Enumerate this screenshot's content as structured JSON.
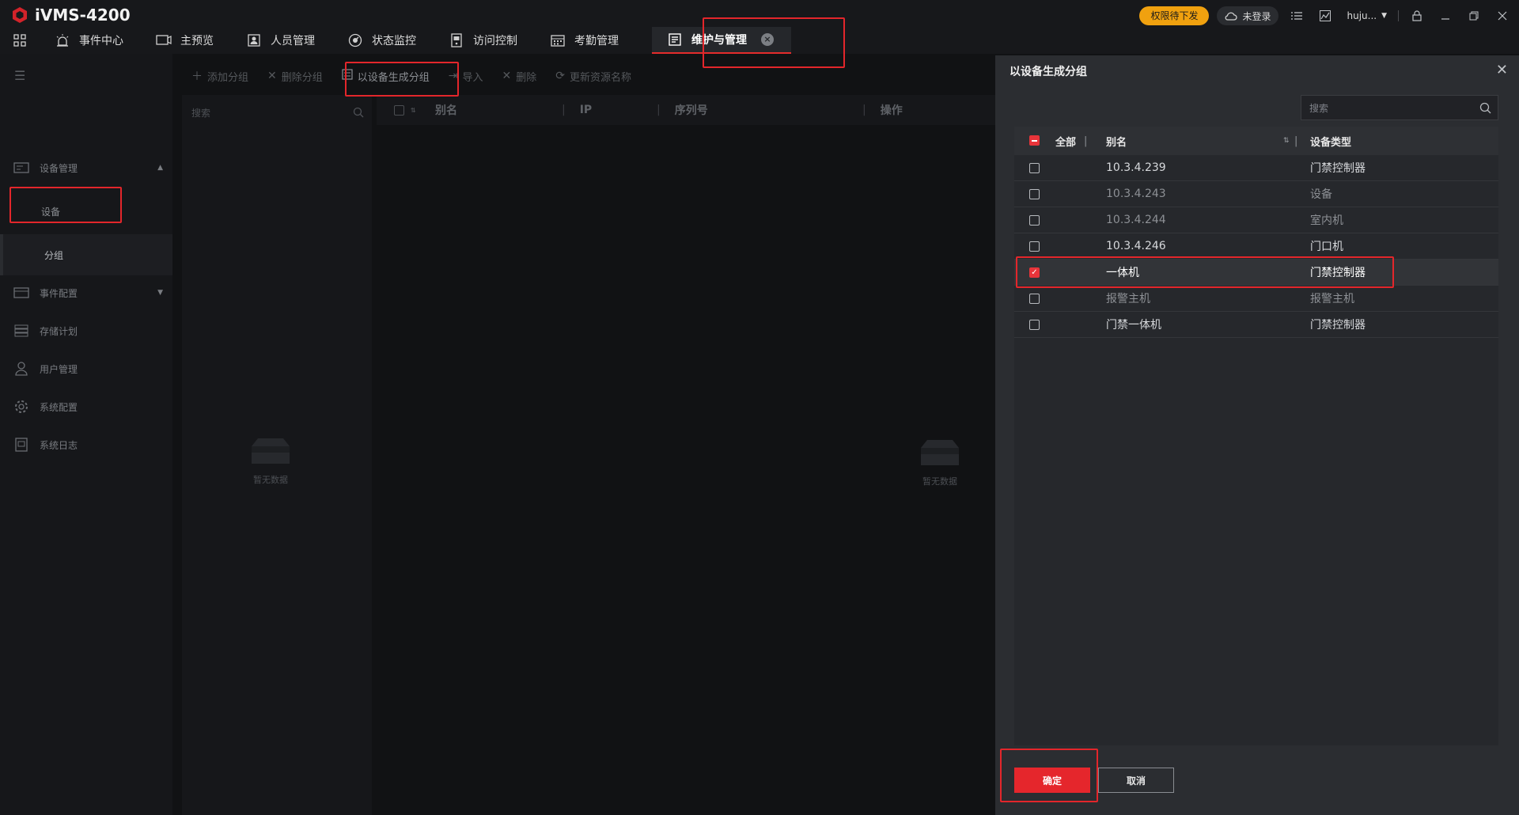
{
  "app": {
    "title": "iVMS-4200"
  },
  "topbar": {
    "perm_badge": "权限待下发",
    "cloud_status": "未登录",
    "user_name": "huju...",
    "icons": [
      "list-icon",
      "chart-icon",
      "lock-icon",
      "minimize-icon",
      "restore-icon",
      "close-icon"
    ]
  },
  "nav": {
    "items": [
      {
        "label": "事件中心",
        "icon": "alarm-light-icon"
      },
      {
        "label": "主预览",
        "icon": "monitor-icon"
      },
      {
        "label": "人员管理",
        "icon": "person-card-icon"
      },
      {
        "label": "状态监控",
        "icon": "gauge-icon"
      },
      {
        "label": "访问控制",
        "icon": "door-icon"
      },
      {
        "label": "考勤管理",
        "icon": "calendar-icon"
      }
    ],
    "active": {
      "label": "维护与管理",
      "icon": "maintenance-icon"
    }
  },
  "sidebar": {
    "items": [
      {
        "label": "设备管理",
        "icon": "device-icon",
        "expanded": true,
        "children": [
          {
            "label": "设备"
          },
          {
            "label": "分组",
            "selected": true
          }
        ]
      },
      {
        "label": "事件配置",
        "icon": "event-config-icon",
        "expanded": false
      },
      {
        "label": "存储计划",
        "icon": "storage-icon"
      },
      {
        "label": "用户管理",
        "icon": "user-icon"
      },
      {
        "label": "系统配置",
        "icon": "settings-icon"
      },
      {
        "label": "系统日志",
        "icon": "log-icon"
      }
    ]
  },
  "toolbar": {
    "add_group": "添加分组",
    "delete_group": "删除分组",
    "create_by_device": "以设备生成分组",
    "import": "导入",
    "delete": "删除",
    "update_names": "更新资源名称"
  },
  "group_panel": {
    "search_placeholder": "搜索",
    "empty_text": "暂无数据"
  },
  "list_panel": {
    "columns": [
      "别名",
      "IP",
      "序列号",
      "操作"
    ],
    "empty_text": "暂无数据"
  },
  "dialog": {
    "title": "以设备生成分组",
    "search_placeholder": "搜索",
    "header": {
      "all": "全部",
      "alias": "别名",
      "type": "设备类型"
    },
    "rows": [
      {
        "alias": "10.3.4.239",
        "type": "门禁控制器",
        "checked": false,
        "dim": false
      },
      {
        "alias": "10.3.4.243",
        "type": "设备",
        "checked": false,
        "dim": true
      },
      {
        "alias": "10.3.4.244",
        "type": "室内机",
        "checked": false,
        "dim": true
      },
      {
        "alias": "10.3.4.246",
        "type": "门口机",
        "checked": false,
        "dim": false
      },
      {
        "alias": "一体机",
        "type": "门禁控制器",
        "checked": true,
        "dim": false
      },
      {
        "alias": "报警主机",
        "type": "报警主机",
        "checked": false,
        "dim": true
      },
      {
        "alias": "门禁一体机",
        "type": "门禁控制器",
        "checked": false,
        "dim": false
      }
    ],
    "ok": "确定",
    "cancel": "取消"
  },
  "colors": {
    "accent": "#e5262c",
    "badge": "#f0a10f",
    "highlight_box": "#e3262b"
  }
}
